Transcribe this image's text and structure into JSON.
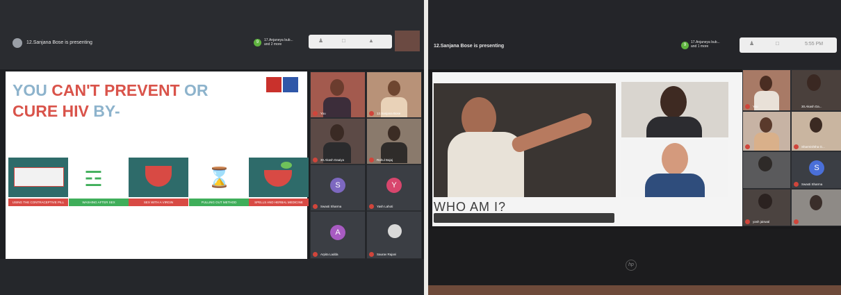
{
  "left_meeting": {
    "presenter": "12.Sanjana Bose is presenting",
    "others": [
      "17.Anjaneya bub...",
      "and 2 more"
    ],
    "slide": {
      "title_line1_a": "YOU ",
      "title_line1_b": "CAN'T PREVENT",
      "title_line1_c": " OR",
      "title_line2_a": "CURE HIV",
      "title_line2_b": " BY-",
      "captions": [
        "USING THE CONTRACEPTIVE PILL",
        "WASHING AFTER SEX",
        "SEX WITH A VIRGIN",
        "PULLING OUT METHOD",
        "SPELLS AND HERBAL MEDICINE"
      ]
    },
    "participants": [
      {
        "name": "You"
      },
      {
        "name": "12.Sanjana Bose"
      },
      {
        "name": "30.Akash Daaiya"
      },
      {
        "name": "Rahul Bajaj"
      },
      {
        "name": "Swasti Sharma",
        "letter": "S"
      },
      {
        "name": "Yash Lahoti",
        "letter": "Y"
      },
      {
        "name": "Arpita Ladda",
        "letter": "A"
      },
      {
        "name": "Saurav Rajani"
      }
    ]
  },
  "right_meeting": {
    "presenter": "12.Sanjana Bose is presenting",
    "others": [
      "17.Anjaneya bub...",
      "and 1 more"
    ],
    "clock": "5:55 PM",
    "slide": {
      "question": "WHO AM I?"
    },
    "participants": [
      {
        "name": "You"
      },
      {
        "name": "30.Akash Da..."
      },
      {
        "name": ""
      },
      {
        "name": "Sharmishtha G..."
      },
      {
        "name": ""
      },
      {
        "name": "Swasti Sharma",
        "letter": "S"
      },
      {
        "name": "yash jaiswal"
      },
      {
        "name": ""
      }
    ]
  },
  "colors": {
    "title_blue": "#8db3cc",
    "title_red": "#d9534a",
    "card_teal": "#2e6b6a",
    "caption_green": "#3fae5a",
    "caption_red": "#d84a44",
    "mic_red": "#d0453b",
    "green_badge": "#5fb33f"
  }
}
